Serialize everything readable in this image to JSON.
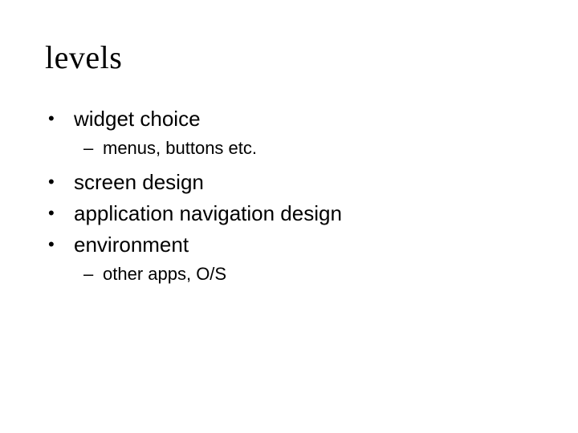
{
  "title": "levels",
  "items": [
    {
      "text": "widget choice",
      "sub": "menus, buttons etc."
    },
    {
      "text": "screen design"
    },
    {
      "text": "application navigation design"
    },
    {
      "text": "environment",
      "sub": "other apps, O/S"
    }
  ]
}
